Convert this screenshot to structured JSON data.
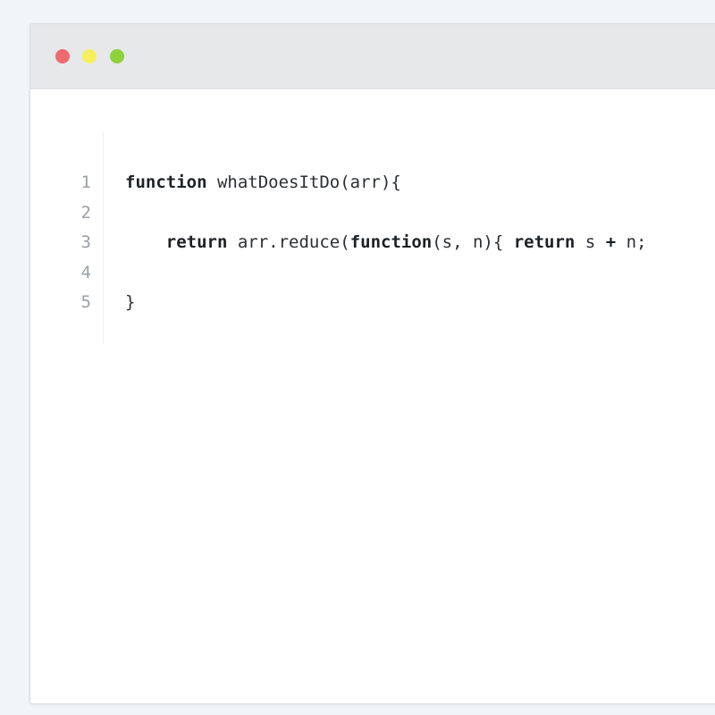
{
  "window": {
    "traffic_lights": [
      {
        "name": "close",
        "color": "#ee6b70"
      },
      {
        "name": "minimize",
        "color": "#f5ef5d"
      },
      {
        "name": "maximize",
        "color": "#8fd13a"
      }
    ]
  },
  "editor": {
    "lines": [
      {
        "number": "1",
        "tokens": [
          {
            "text": "function",
            "kind": "keyword"
          },
          {
            "text": " whatDoesItDo(arr){",
            "kind": "plain"
          }
        ]
      },
      {
        "number": "2",
        "tokens": []
      },
      {
        "number": "3",
        "tokens": [
          {
            "text": "    ",
            "kind": "plain"
          },
          {
            "text": "return",
            "kind": "keyword"
          },
          {
            "text": " arr.reduce(",
            "kind": "plain"
          },
          {
            "text": "function",
            "kind": "keyword"
          },
          {
            "text": "(s, n){ ",
            "kind": "plain"
          },
          {
            "text": "return",
            "kind": "keyword"
          },
          {
            "text": " s ",
            "kind": "plain"
          },
          {
            "text": "+",
            "kind": "keyword"
          },
          {
            "text": " n;",
            "kind": "plain"
          }
        ]
      },
      {
        "number": "4",
        "tokens": []
      },
      {
        "number": "5",
        "tokens": [
          {
            "text": "}",
            "kind": "plain"
          }
        ]
      }
    ]
  }
}
